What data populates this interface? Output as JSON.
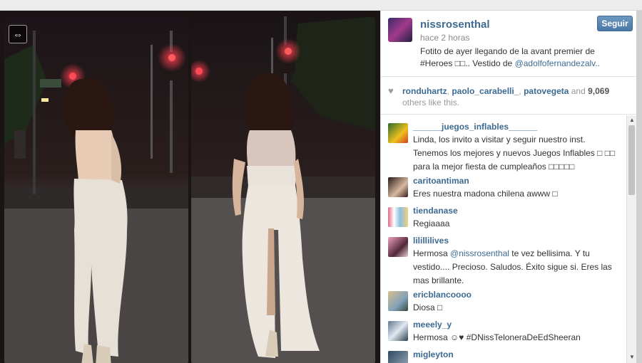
{
  "post": {
    "username": "nissrosenthal",
    "time": "hace 2 horas",
    "caption_text": "Fotito de ayer llegando de la avant premier de #Heroes □□.. Vestido de ",
    "caption_mention": "@adolfofernandezalv..",
    "follow_label": "Seguir"
  },
  "likes": {
    "user1": "ronduhartz",
    "sep1": ", ",
    "user2": "paolo_carabelli_",
    "sep2": ", ",
    "user3": "patovegeta",
    "and": " and ",
    "count": "9,069",
    "suffix": " others like this."
  },
  "comments": [
    {
      "user": "______juegos_inflables______",
      "text": "Linda, los invito a visitar y seguir nuestro inst. Tenemos los mejores y nuevos Juegos Inflables □ □□ para la mejor fiesta de cumpleaños □□□□□"
    },
    {
      "user": "caritoantiman",
      "text": "Eres nuestra madona chilena awww □"
    },
    {
      "user": "tiendanase",
      "text": "Regiaaaa"
    },
    {
      "user": "lilillilives",
      "text_pre": "Hermosa ",
      "mention": "@nissrosenthal",
      "text_post": " te vez bellisima. Y tu vestido.... Precioso. Saludos. Éxito sigue si. Eres las mas brillante."
    },
    {
      "user": "ericblancoooo",
      "text": "Diosa □"
    },
    {
      "user": "meeely_y",
      "text": "Hermosa ☺♥ #DNissTeloneraDeEdSheeran"
    },
    {
      "user": "migleyton",
      "text": ""
    }
  ],
  "icons": {
    "heart": "heart-icon",
    "expand": "expand-icon",
    "scroll_up": "scroll-up-arrow-icon",
    "scroll_down": "scroll-down-arrow-icon"
  },
  "colors": {
    "link": "#3c6a92",
    "follow_button": "#4a78a6"
  }
}
